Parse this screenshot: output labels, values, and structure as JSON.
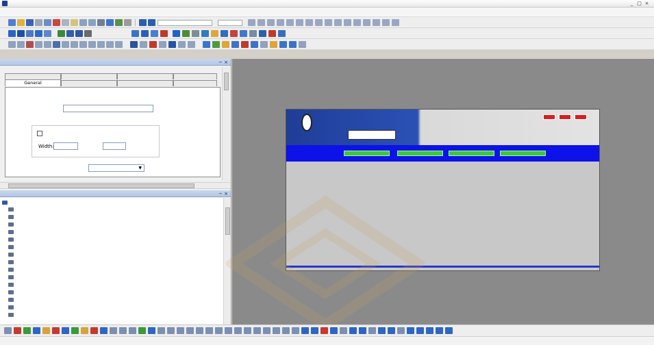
{
  "window": {
    "title": "",
    "buttons": [
      "_",
      "□",
      "×"
    ]
  },
  "menu": {
    "items": [
      "",
      "",
      "",
      "",
      "",
      "",
      "",
      "",
      ""
    ]
  },
  "toolbars": {
    "style_combo": "",
    "size_combo": ""
  },
  "page_properties": {
    "header": "",
    "close": "− ×",
    "tabs_row1": [
      "",
      "",
      "",
      ""
    ],
    "tabs_row2": [
      "General",
      "",
      "",
      ""
    ],
    "title_label": "",
    "title_value": "",
    "page_size_label": "",
    "use_default_label": "",
    "width_label": "Width:",
    "width_value": "",
    "height_label": "",
    "height_value": "",
    "alignment_label": "",
    "alignment_value": "",
    "dropdown_arrow": "▼"
  },
  "site_explorer": {
    "header": "",
    "close": "− ×",
    "root": "",
    "items": [
      "",
      "",
      "",
      "",
      "",
      "",
      "",
      "",
      "",
      "",
      "",
      "",
      "",
      "",
      ""
    ]
  },
  "design": {
    "header_left_text": "",
    "header_input": "",
    "title_line1": "",
    "title_line2": "",
    "top_buttons": [
      "",
      "",
      ""
    ],
    "nav_buttons": [
      "",
      "",
      "",
      ""
    ]
  },
  "status": {
    "left": "",
    "middle": "",
    "right": ""
  },
  "colors": {
    "header_blue": "#1f3d97",
    "nav_blue": "#0c12e8",
    "nav_green": "#41c441",
    "top_red": "#d52020",
    "workspace_gray": "#8a8a8a",
    "page_gray": "#c8c8c8"
  }
}
